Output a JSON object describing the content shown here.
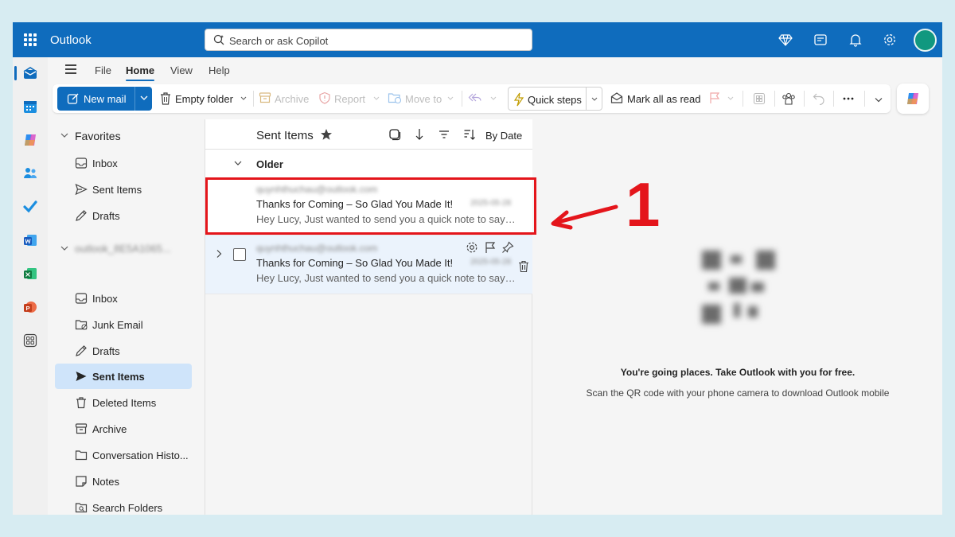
{
  "app": {
    "name": "Outlook",
    "search_placeholder": "Search or ask Copilot",
    "accent": "#0f6cbd"
  },
  "menu": {
    "items": [
      "File",
      "Home",
      "View",
      "Help"
    ],
    "active": "Home"
  },
  "ribbon": {
    "new_mail": "New mail",
    "empty_folder": "Empty folder",
    "archive": "Archive",
    "report": "Report",
    "move_to": "Move to",
    "quick_steps": "Quick steps",
    "mark_all_as_read": "Mark all as read"
  },
  "nav": {
    "favorites": {
      "label": "Favorites",
      "items": [
        {
          "label": "Inbox",
          "icon": "inbox-icon"
        },
        {
          "label": "Sent Items",
          "icon": "send-icon"
        },
        {
          "label": "Drafts",
          "icon": "pencil-icon"
        }
      ]
    },
    "account": {
      "label": "outlook_8E5A1065...",
      "items": [
        {
          "label": "Inbox",
          "icon": "inbox-icon"
        },
        {
          "label": "Junk Email",
          "icon": "junk-icon"
        },
        {
          "label": "Drafts",
          "icon": "pencil-icon"
        },
        {
          "label": "Sent Items",
          "icon": "send-icon",
          "selected": true
        },
        {
          "label": "Deleted Items",
          "icon": "trash-icon"
        },
        {
          "label": "Archive",
          "icon": "archive-icon"
        },
        {
          "label": "Conversation Histo...",
          "icon": "folder-icon"
        },
        {
          "label": "Notes",
          "icon": "note-icon"
        },
        {
          "label": "Search Folders",
          "icon": "search-folder-icon"
        }
      ]
    }
  },
  "list": {
    "folder_title": "Sent Items",
    "sort_label": "By Date",
    "group_label": "Older",
    "messages": [
      {
        "from": "quynhthuchau@outlook.com",
        "date": "2025-05-28",
        "subject": "Thanks for Coming – So Glad You Made It!",
        "preview": "Hey Lucy, Just wanted to send you a quick note to say t..."
      },
      {
        "from": "quynhthuchau@outlook.com",
        "date": "2025-05-28",
        "subject": "Thanks for Coming – So Glad You Made It!",
        "preview": "Hey Lucy, Just wanted to send you a quick note to say t..."
      }
    ]
  },
  "reading": {
    "promo_title": "You're going places. Take Outlook with you for free.",
    "promo_body": "Scan the QR code with your phone camera to download Outlook mobile"
  },
  "annotation": {
    "number": "1",
    "color": "#e4151b"
  }
}
